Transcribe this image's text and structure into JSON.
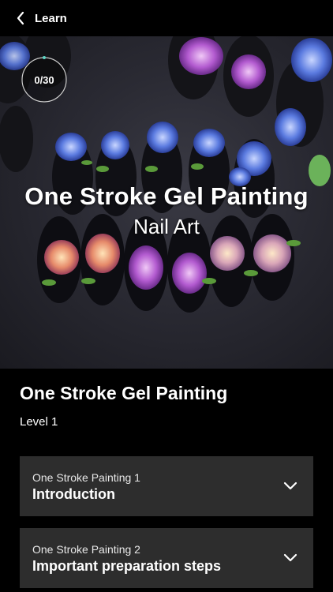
{
  "header": {
    "title": "Learn"
  },
  "hero": {
    "progress_label": "0/30",
    "progress_fraction": 0.0,
    "title": "One Stroke Gel Painting",
    "subtitle": "Nail Art"
  },
  "course": {
    "title": "One Stroke Gel Painting",
    "level": "Level 1"
  },
  "lessons": [
    {
      "subtitle": "One Stroke Painting 1",
      "title": "Introduction"
    },
    {
      "subtitle": "One Stroke Painting 2",
      "title": "Important preparation steps"
    }
  ],
  "colors": {
    "background": "#000000",
    "card": "#2d2d2d",
    "accent": "#5fd3c4"
  }
}
